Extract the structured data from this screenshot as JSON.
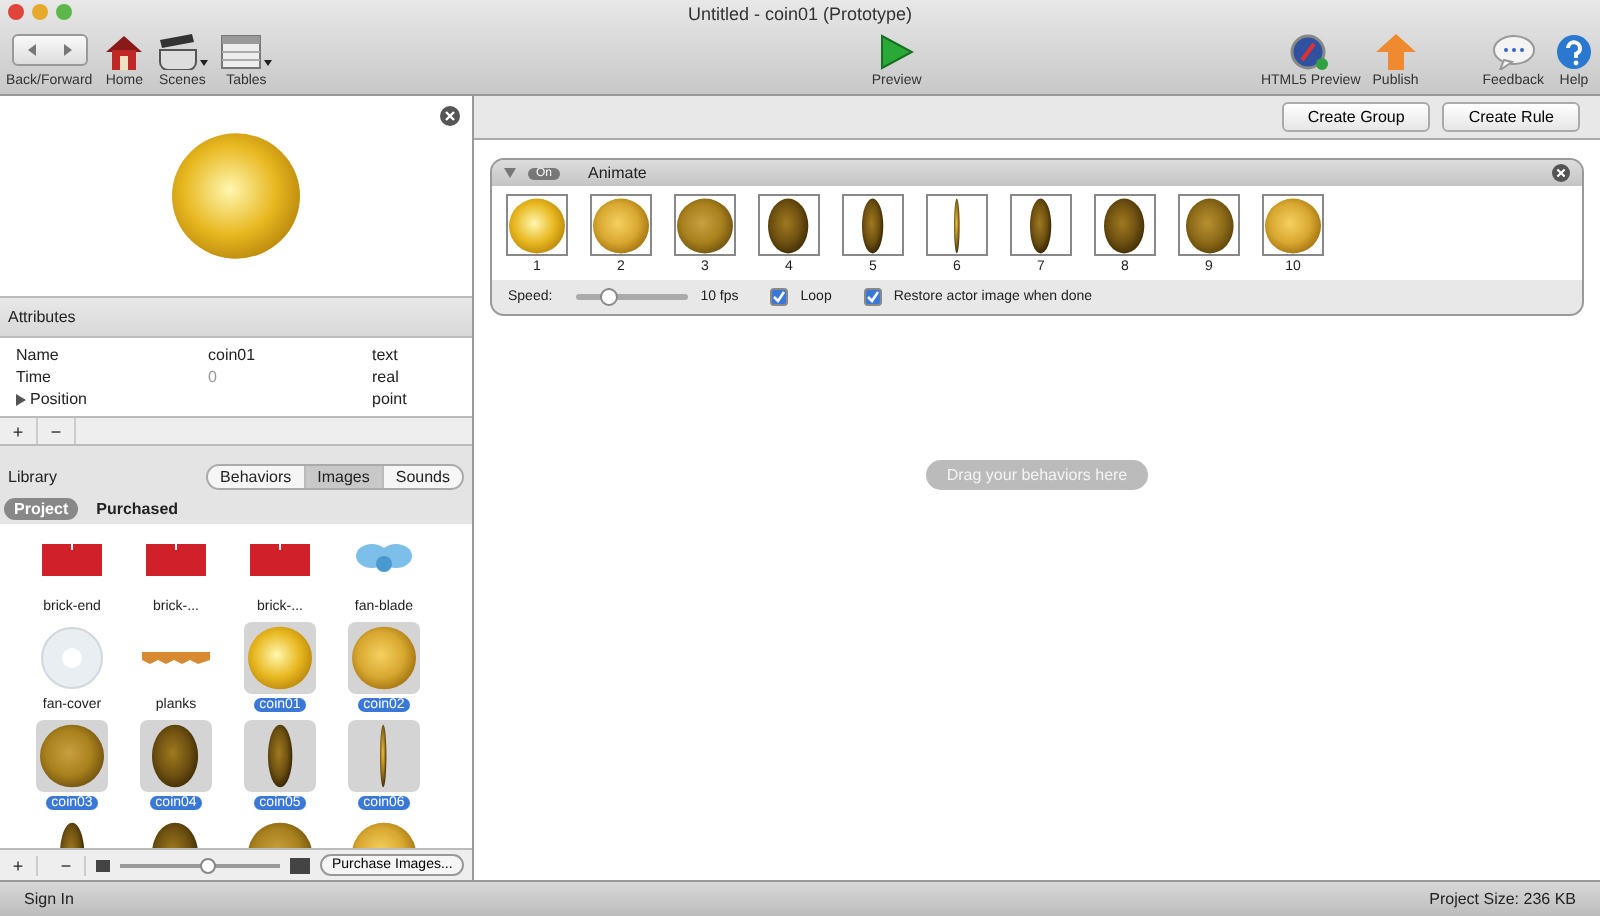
{
  "window": {
    "title": "Untitled - coin01 (Prototype)"
  },
  "toolbar": {
    "left": [
      {
        "kind": "backforward",
        "label": "Back/Forward"
      },
      {
        "kind": "home",
        "label": "Home"
      },
      {
        "kind": "scenes",
        "label": "Scenes"
      },
      {
        "kind": "tables",
        "label": "Tables"
      }
    ],
    "center": [
      {
        "kind": "preview",
        "label": "Preview"
      }
    ],
    "right": [
      {
        "kind": "html5",
        "label": "HTML5 Preview"
      },
      {
        "kind": "publish",
        "label": "Publish"
      },
      {
        "kind": "feedback",
        "label": "Feedback"
      },
      {
        "kind": "help",
        "label": "Help"
      }
    ]
  },
  "actor_preview": {
    "kind": "coin-bright"
  },
  "attributes": {
    "title": "Attributes",
    "rows": [
      {
        "name": "Name",
        "value": "coin01",
        "type": "text",
        "expandable": false
      },
      {
        "name": "Time",
        "value": "0",
        "type": "real",
        "expandable": false
      },
      {
        "name": "Position",
        "type": "point",
        "expandable": true
      }
    ],
    "buttons": [
      "+",
      "−"
    ]
  },
  "library": {
    "title": "Library",
    "tabs": [
      {
        "label": "Behaviors",
        "selected": false
      },
      {
        "label": "Images",
        "selected": true
      },
      {
        "label": "Sounds",
        "selected": false
      }
    ],
    "scopes": [
      {
        "label": "Project",
        "selected": true
      },
      {
        "label": "Purchased",
        "selected": false
      }
    ],
    "items": [
      {
        "name": "brick-end",
        "kind": "brick",
        "selected": false
      },
      {
        "name": "brick-...",
        "kind": "brick",
        "selected": false
      },
      {
        "name": "brick-...",
        "kind": "brick",
        "selected": false
      },
      {
        "name": "fan-blade",
        "kind": "fan-blade",
        "selected": false
      },
      {
        "name": "fan-cover",
        "kind": "fan-cover",
        "selected": false
      },
      {
        "name": "planks",
        "kind": "planks",
        "selected": false
      },
      {
        "name": "coin01",
        "kind": "coin-bright",
        "selected": true
      },
      {
        "name": "coin02",
        "kind": "coin-gold",
        "selected": true
      },
      {
        "name": "coin03",
        "kind": "coin-face",
        "selected": true
      },
      {
        "name": "coin04",
        "kind": "coin-oval",
        "selected": true
      },
      {
        "name": "coin05",
        "kind": "coin-narrow",
        "selected": true
      },
      {
        "name": "coin06",
        "kind": "coin-edge",
        "selected": true
      },
      {
        "kind": "coin-narrow",
        "selected": false
      },
      {
        "kind": "coin-oval",
        "selected": false
      },
      {
        "kind": "coin-face",
        "selected": false
      },
      {
        "kind": "coin-gold",
        "selected": false
      }
    ],
    "bottom_buttons": [
      "+",
      "−"
    ],
    "zoom_slider": {
      "level": 0.55
    },
    "purchase_button": "Purchase Images..."
  },
  "right_buttons": [
    "Create Group",
    "Create Rule"
  ],
  "behavior": {
    "switch": {
      "label": "On",
      "on": true
    },
    "title": "Animate",
    "frames": [
      {
        "label": "1",
        "kind": "coin-bright"
      },
      {
        "label": "2",
        "kind": "coin-gold"
      },
      {
        "label": "3",
        "kind": "coin-face"
      },
      {
        "label": "4",
        "kind": "coin-oval"
      },
      {
        "label": "5",
        "kind": "coin-narrow"
      },
      {
        "label": "6",
        "kind": "coin-edge"
      },
      {
        "label": "7",
        "kind": "coin-narrow"
      },
      {
        "label": "8",
        "kind": "coin-oval"
      },
      {
        "label": "9",
        "kind": "coin-tilt"
      },
      {
        "label": "10",
        "kind": "coin-gold"
      }
    ],
    "speed_label": "Speed:",
    "speed": {
      "level": 0.3
    },
    "speed_reading": "10 fps",
    "loop": {
      "label": "Loop",
      "checked": true
    },
    "restore": {
      "label": "Restore actor image when done",
      "checked": true
    }
  },
  "drop_hint": "Drag your behaviors here",
  "status_bar": {
    "left": "Sign In",
    "right": "Project Size: 236 KB"
  }
}
